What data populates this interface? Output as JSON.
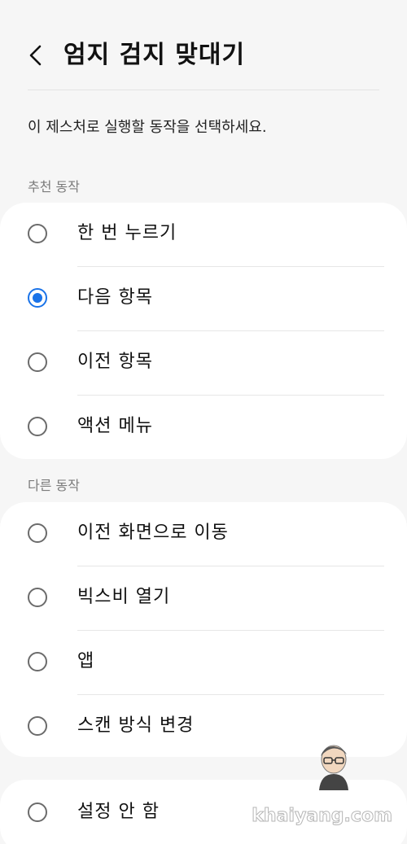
{
  "header": {
    "title": "엄지 검지 맞대기",
    "back_icon": "chevron-left-icon"
  },
  "description": "이 제스처로 실행할 동작을 선택하세요.",
  "sections": [
    {
      "title": "추천 동작",
      "options": [
        {
          "label": "한 번 누르기",
          "selected": false
        },
        {
          "label": "다음 항목",
          "selected": true
        },
        {
          "label": "이전 항목",
          "selected": false
        },
        {
          "label": "액션 메뉴",
          "selected": false
        }
      ]
    },
    {
      "title": "다른 동작",
      "options": [
        {
          "label": "이전 화면으로 이동",
          "selected": false
        },
        {
          "label": "빅스비 열기",
          "selected": false
        },
        {
          "label": "앱",
          "selected": false
        },
        {
          "label": "스캔 방식 변경",
          "selected": false
        }
      ]
    }
  ],
  "none_option": {
    "label": "설정 안 함",
    "selected": false
  },
  "watermark": {
    "text": "khaiyang.com"
  },
  "colors": {
    "accent": "#1a73e8",
    "background": "#f6f6f6",
    "card": "#ffffff"
  }
}
